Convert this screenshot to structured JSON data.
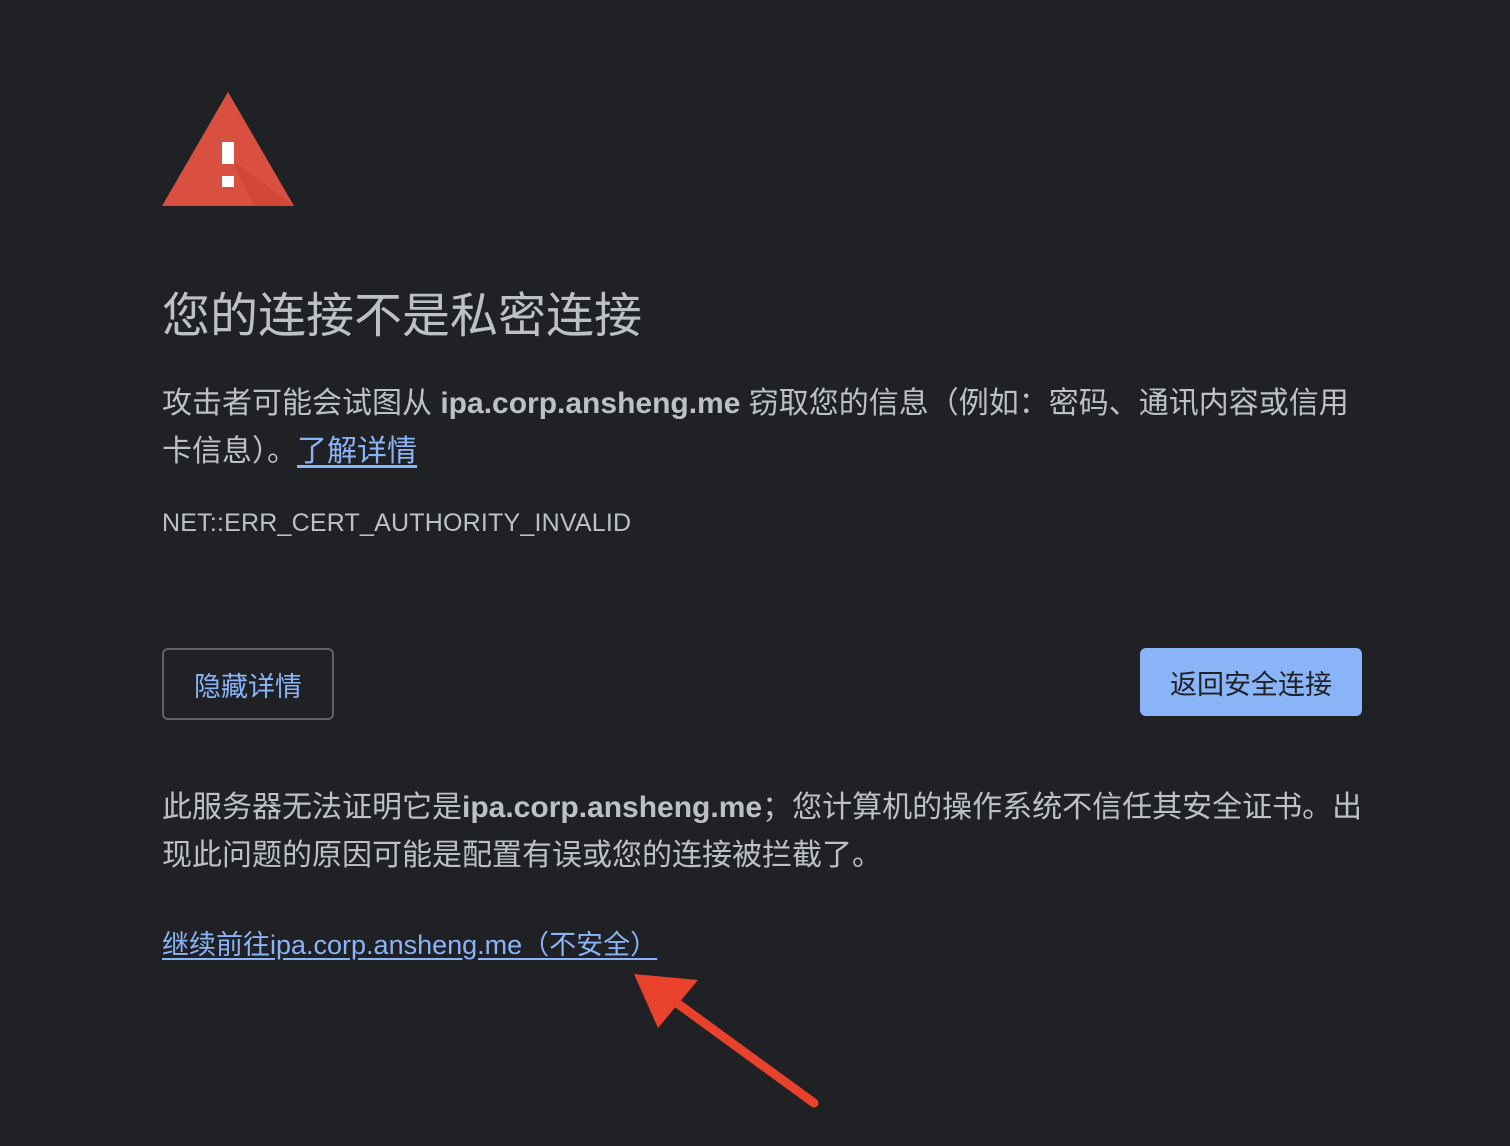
{
  "title": "您的连接不是私密连接",
  "explanation": {
    "prefix": "攻击者可能会试图从 ",
    "host": "ipa.corp.ansheng.me",
    "suffix": " 窃取您的信息（例如：密码、通讯内容或信用卡信息）。",
    "learn_more": "了解详情"
  },
  "error_code": "NET::ERR_CERT_AUTHORITY_INVALID",
  "buttons": {
    "details": "隐藏详情",
    "back": "返回安全连接"
  },
  "details": {
    "prefix": "此服务器无法证明它是",
    "host": "ipa.corp.ansheng.me",
    "suffix": "；您计算机的操作系统不信任其安全证书。出现此问题的原因可能是配置有误或您的连接被拦截了。"
  },
  "proceed_link": "继续前往ipa.corp.ansheng.me（不安全）",
  "colors": {
    "background": "#202124",
    "text": "#bdc1c6",
    "link": "#8ab4f8",
    "warning_red": "#d95040",
    "annotation_red": "#e8412c"
  },
  "icons": {
    "warning": "warning-triangle-icon",
    "annotation": "red-arrow-icon"
  }
}
